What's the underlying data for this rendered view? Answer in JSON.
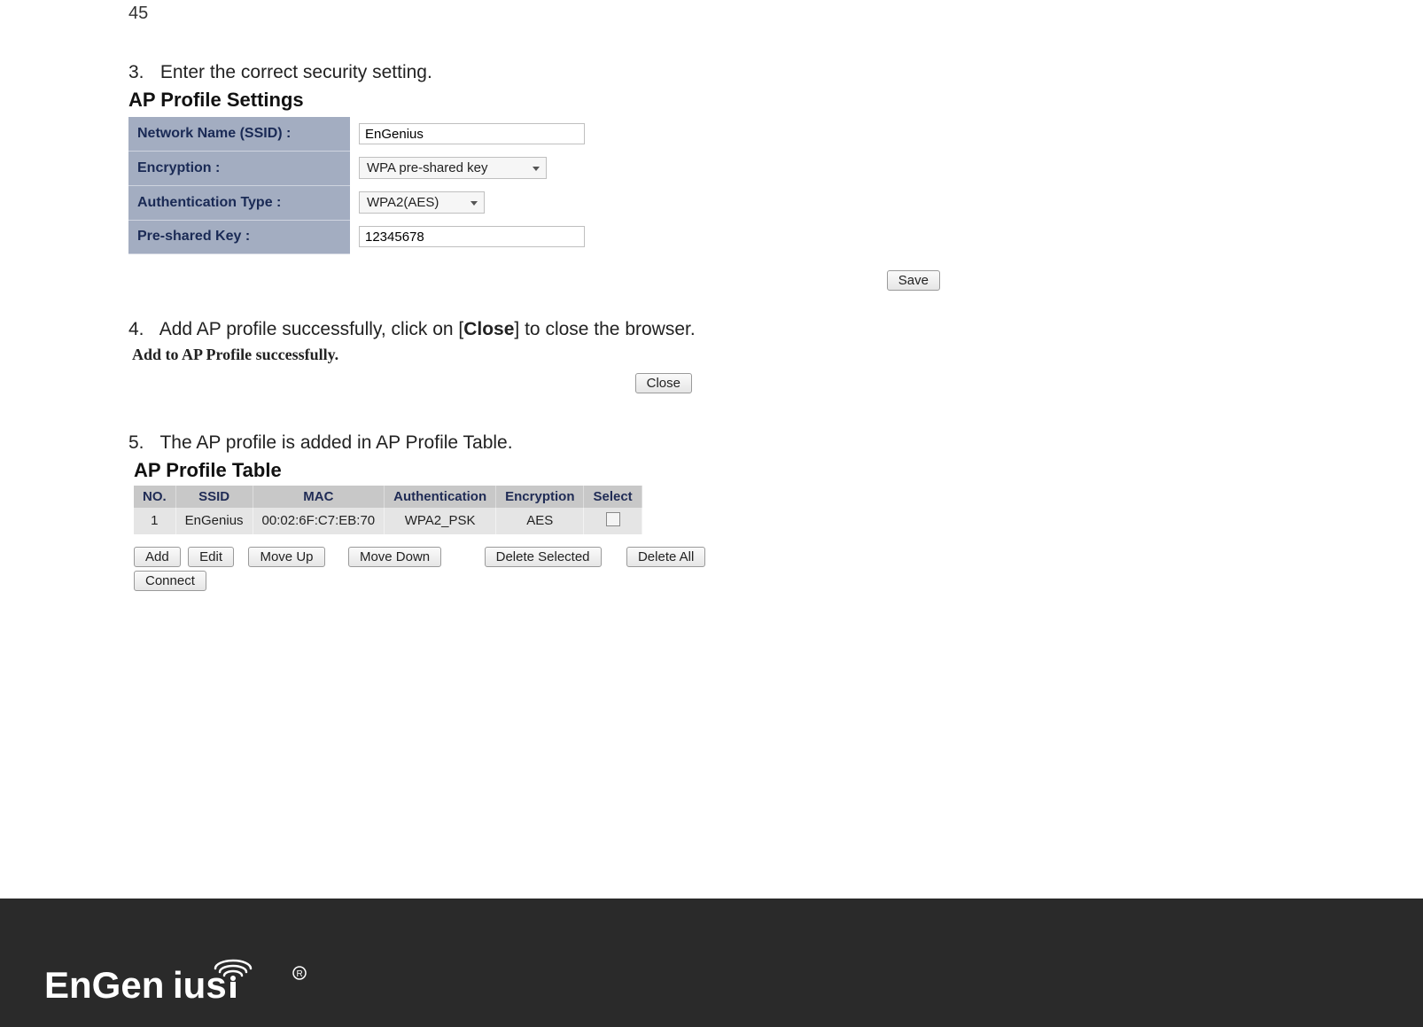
{
  "page_number": "45",
  "steps": {
    "s3": {
      "num": "3.",
      "text": "Enter the correct security setting."
    },
    "s4": {
      "num": "4.",
      "text_pre": "Add AP profile successfully, click on [",
      "text_bold": "Close",
      "text_post": "] to close the browser."
    },
    "s5": {
      "num": "5.",
      "text": "The AP profile is added in AP Profile Table."
    }
  },
  "ap_settings": {
    "title": "AP Profile Settings",
    "rows": {
      "ssid_label": "Network Name (SSID) :",
      "ssid_value": "EnGenius",
      "enc_label": "Encryption :",
      "enc_value": "WPA pre-shared key",
      "auth_label": "Authentication Type :",
      "auth_value": "WPA2(AES)",
      "psk_label": "Pre-shared Key :",
      "psk_value": "12345678"
    },
    "save_label": "Save"
  },
  "success": {
    "message": "Add to AP Profile successfully.",
    "close_label": "Close"
  },
  "ap_table": {
    "title": "AP Profile Table",
    "headers": {
      "no": "NO.",
      "ssid": "SSID",
      "mac": "MAC",
      "auth": "Authentication",
      "enc": "Encryption",
      "sel": "Select"
    },
    "row1": {
      "no": "1",
      "ssid": "EnGenius",
      "mac": "00:02:6F:C7:EB:70",
      "auth": "WPA2_PSK",
      "enc": "AES"
    },
    "buttons": {
      "add": "Add",
      "edit": "Edit",
      "up": "Move Up",
      "down": "Move Down",
      "del_sel": "Delete Selected",
      "del_all": "Delete All",
      "connect": "Connect"
    }
  },
  "brand": "EnGenius"
}
